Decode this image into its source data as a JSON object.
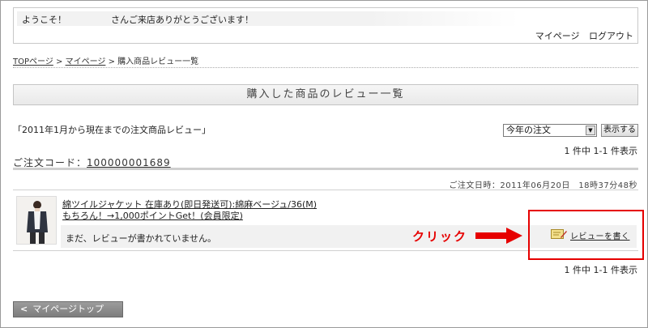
{
  "welcome": {
    "text": "ようこそ！　　　　　さんご来店ありがとうございます！",
    "links": [
      "マイページ",
      "ログアウト"
    ]
  },
  "breadcrumb": {
    "items": [
      "TOPページ",
      "マイページ",
      "購入商品レビュー一覧"
    ],
    "separator": ">"
  },
  "page_title": "購入した商品のレビュー一覧",
  "period": {
    "text": "「2011年1月から現在までの注文商品レビュー」",
    "select_value": "今年の注文",
    "show_button": "表示する"
  },
  "count_text": "1 件中 1-1 件表示",
  "order": {
    "code_label": "ご注文コード：",
    "code_value": "100000001689",
    "date": "ご注文日時：2011年06月20日　18時37分48秒"
  },
  "item": {
    "name_line1": "綿ツイルジャケット 在庫あり(即日発送可):綿麻ベージュ/36(M)",
    "name_line2": "もちろん！→1,000ポイントGet！(会員限定)",
    "no_review": "まだ、レビューが書かれていません。",
    "write_review": "レビューを書く"
  },
  "annotation": {
    "click": "クリック",
    "color": "#e60000"
  },
  "back_button": "マイページトップ",
  "colors": {
    "accent": "#e60000",
    "button_gray": "#8a8a8a"
  },
  "icons": [
    "pencil-note-icon",
    "chevron-left-icon",
    "dropdown-arrow-icon"
  ]
}
